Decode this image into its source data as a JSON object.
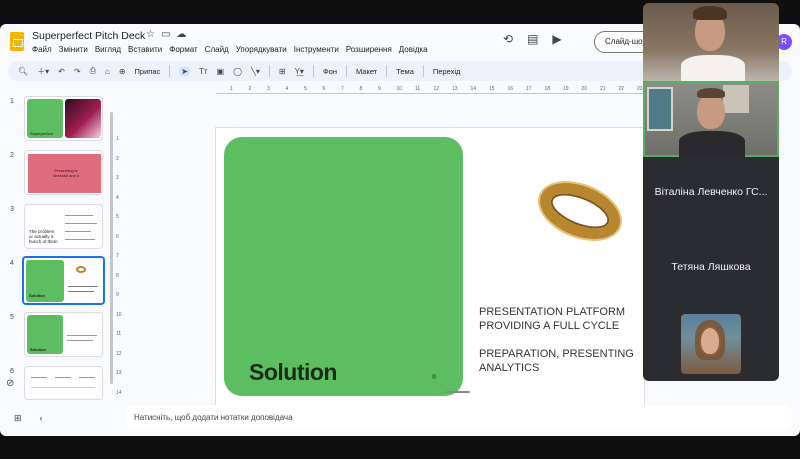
{
  "header": {
    "doc_title": "Superperfect Pitch Deck",
    "title_icons": [
      "star-icon",
      "folder-icon",
      "cloud-icon"
    ],
    "menu": [
      "Файл",
      "Змінити",
      "Вигляд",
      "Вставити",
      "Формат",
      "Слайд",
      "Упорядкувати",
      "Інструменти",
      "Розширення",
      "Довідка"
    ],
    "right_icons": [
      "history-icon",
      "comment-icon",
      "video-call-icon"
    ],
    "slideshow_label": "Слайд-шоу",
    "avatar_letter": "R"
  },
  "toolbar": {
    "zoom_label": "Припас",
    "background_label": "Фон",
    "layout_label": "Макет",
    "theme_label": "Тема",
    "transition_label": "Перехід"
  },
  "filmstrip": {
    "slides": [
      {
        "num": "1",
        "text": "Superperfect"
      },
      {
        "num": "2",
        "text": "Presenting is stressful and it"
      },
      {
        "num": "3",
        "text": "The problem or actually a bunch of them"
      },
      {
        "num": "4",
        "text": "Solution",
        "active": true
      },
      {
        "num": "5",
        "text": "Solution"
      },
      {
        "num": "6",
        "text": ""
      }
    ]
  },
  "ruler": {
    "top": [
      "1",
      "2",
      "3",
      "4",
      "5",
      "6",
      "7",
      "8",
      "9",
      "10",
      "11",
      "12",
      "13",
      "14",
      "15",
      "16",
      "17",
      "18",
      "19",
      "20",
      "21",
      "22",
      "23"
    ],
    "left": [
      "1",
      "2",
      "3",
      "4",
      "5",
      "6",
      "7",
      "8",
      "9",
      "10",
      "11",
      "12",
      "13",
      "14"
    ]
  },
  "slide": {
    "card_title": "Solution",
    "card_mark": "®",
    "line1": "PRESENTATION PLATFORM",
    "line2": "PROVIDING A FULL CYCLE",
    "line3": "PREPARATION, PRESENTING",
    "line4": "ANALYTICS"
  },
  "notes": {
    "placeholder": "Натисніть, щоб додати нотатки доповідача"
  },
  "participants": {
    "name1": "Віталіна Левченко ГС...",
    "name2": "Тетяна Ляшкова"
  },
  "colors": {
    "slide_green": "#5cbd61",
    "accent_blue": "#1a73e8",
    "speaking_border": "#54b060"
  }
}
